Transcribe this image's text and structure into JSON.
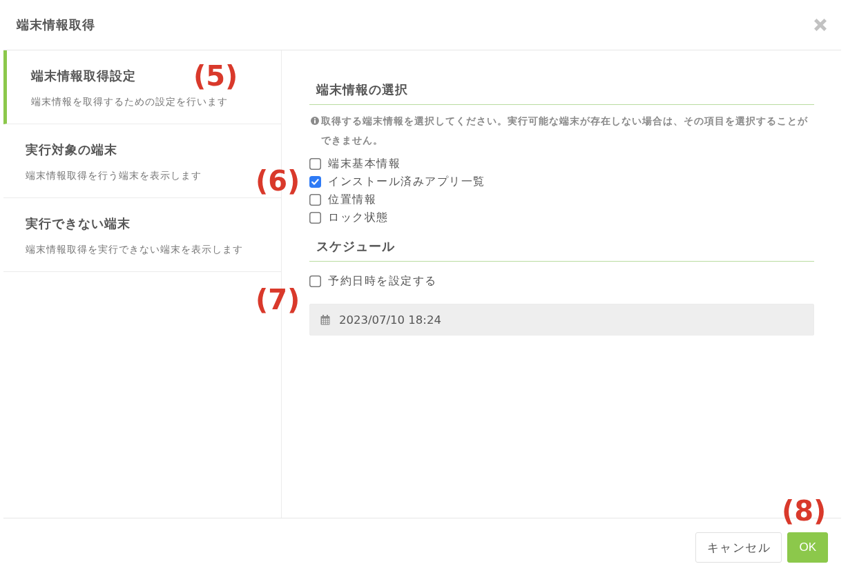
{
  "dialog": {
    "title": "端末情報取得"
  },
  "sidebar": {
    "items": [
      {
        "title": "端末情報取得設定",
        "description": "端末情報を取得するための設定を行います",
        "selected": true
      },
      {
        "title": "実行対象の端末",
        "description": "端末情報取得を行う端末を表示します",
        "selected": false
      },
      {
        "title": "実行できない端末",
        "description": "端末情報取得を実行できない端末を表示します",
        "selected": false
      }
    ]
  },
  "sections": [
    {
      "title": "端末情報の選択",
      "info": "取得する端末情報を選択してください。実行可能な端末が存在しない場合は、その項目を選択することができません。",
      "options": [
        {
          "label": "端末基本情報",
          "checked": false
        },
        {
          "label": "インストール済みアプリ一覧",
          "checked": true
        },
        {
          "label": "位置情報",
          "checked": false
        },
        {
          "label": "ロック状態",
          "checked": false
        }
      ]
    },
    {
      "title": "スケジュール",
      "options": [
        {
          "label": "予約日時を設定する",
          "checked": false
        }
      ],
      "datetime": {
        "value": "2023/07/10 18:24",
        "disabled": true
      }
    }
  ],
  "buttons": [
    {
      "kind": "secondary",
      "label": "キャンセル"
    },
    {
      "kind": "primary",
      "label": "OK"
    }
  ],
  "annotations": [
    {
      "label": "(5)"
    },
    {
      "label": "(6)"
    },
    {
      "label": "(7)"
    },
    {
      "label": "(8)"
    }
  ]
}
